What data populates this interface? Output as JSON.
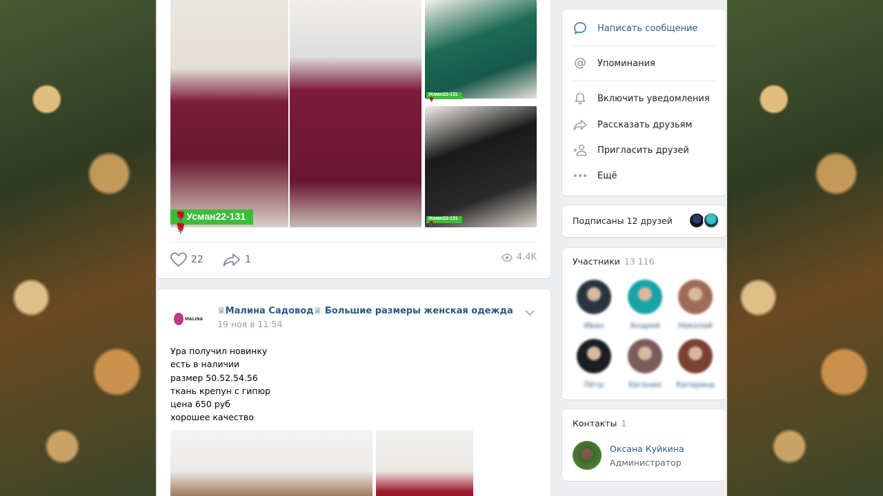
{
  "colors": {
    "link": "#2a5885",
    "muted": "#939fad",
    "page_bg": "#edeef0",
    "tag_green": "#3cbd3a"
  },
  "post1": {
    "photo_tag_main": "🌹Усман22-131🌹",
    "photo_tag_small_1": "Усман22-131🌹",
    "photo_tag_small_2": "Усман22-131🌹",
    "likes": "22",
    "shares": "1",
    "views": "4.4K"
  },
  "post2": {
    "author": "♕Малина Садовод♕ Большие размеры женская одежда",
    "date": "19 ноя в 11:54",
    "logo_text": "MALINA",
    "text_lines": [
      "Ура получил новинку",
      "есть в наличии",
      "размер 50.52.54.56",
      "ткань крепун с гипюр",
      "цена 650 руб",
      "хорошее качество"
    ]
  },
  "sidebar": {
    "menu": {
      "write": "Написать сообщение",
      "mentions": "Упоминания",
      "notify": "Включить уведомления",
      "tell": "Рассказать друзьям",
      "invite": "Пригласить друзей",
      "more": "Ещё"
    },
    "friends_subscribed": "Подписаны 12 друзей",
    "members": {
      "title": "Участники",
      "count": "13 116",
      "people": [
        {
          "name": "Иван",
          "color": "#2a3440"
        },
        {
          "name": "Андрей",
          "color": "#16a4a8"
        },
        {
          "name": "Николай",
          "color": "#a06a58"
        },
        {
          "name": "Пётр",
          "color": "#1b1e24"
        },
        {
          "name": "Евгения",
          "color": "#7a5c5c"
        },
        {
          "name": "Катерина",
          "color": "#7a4030"
        }
      ]
    },
    "contacts": {
      "title": "Контакты",
      "count": "1",
      "name": "Оксана Куйкина",
      "role": "Администратор"
    }
  }
}
